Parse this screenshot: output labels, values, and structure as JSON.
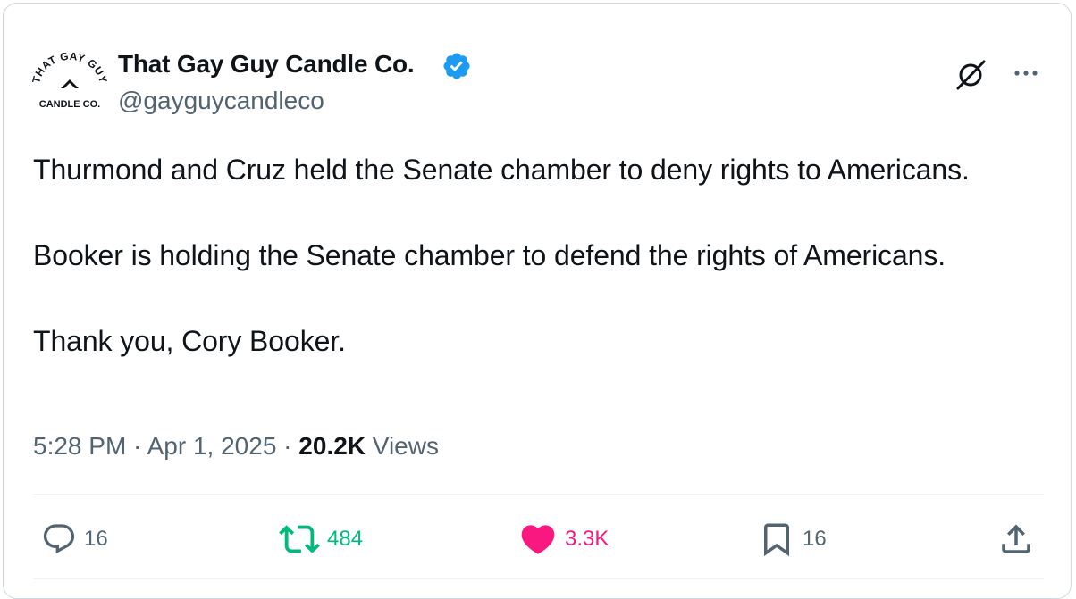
{
  "colors": {
    "text": "#0f1419",
    "secondary": "#536471",
    "border": "#cfd9de",
    "verified": "#1d9bf0",
    "retweet": "#00ba7c",
    "like": "#f91880"
  },
  "tweet": {
    "author": {
      "name": "That Gay Guy Candle Co.",
      "handle": "@gayguycandleco",
      "verified": true,
      "avatar_icon": "candle-logo",
      "avatar_text_top": "THAT GAY GUY",
      "avatar_text_bottom": "CANDLE CO."
    },
    "text": {
      "p1": "Thurmond and Cruz held the Senate chamber to deny rights to Americans.",
      "p2": "Booker is holding the Senate chamber to defend the rights of Americans.",
      "p3": "Thank you, Cory Booker."
    },
    "meta": {
      "time": "5:28 PM",
      "sep1": " · ",
      "date": "Apr 1, 2025",
      "sep2": " · ",
      "views_count": "20.2K",
      "views_label": " Views"
    },
    "actions": {
      "replies": {
        "icon": "reply-icon",
        "count": "16"
      },
      "retweets": {
        "icon": "retweet-icon",
        "count": "484",
        "active": true
      },
      "likes": {
        "icon": "heart-icon",
        "count": "3.3K",
        "active": true
      },
      "bookmarks": {
        "icon": "bookmark-icon",
        "count": "16"
      },
      "share": {
        "icon": "share-icon"
      }
    }
  }
}
